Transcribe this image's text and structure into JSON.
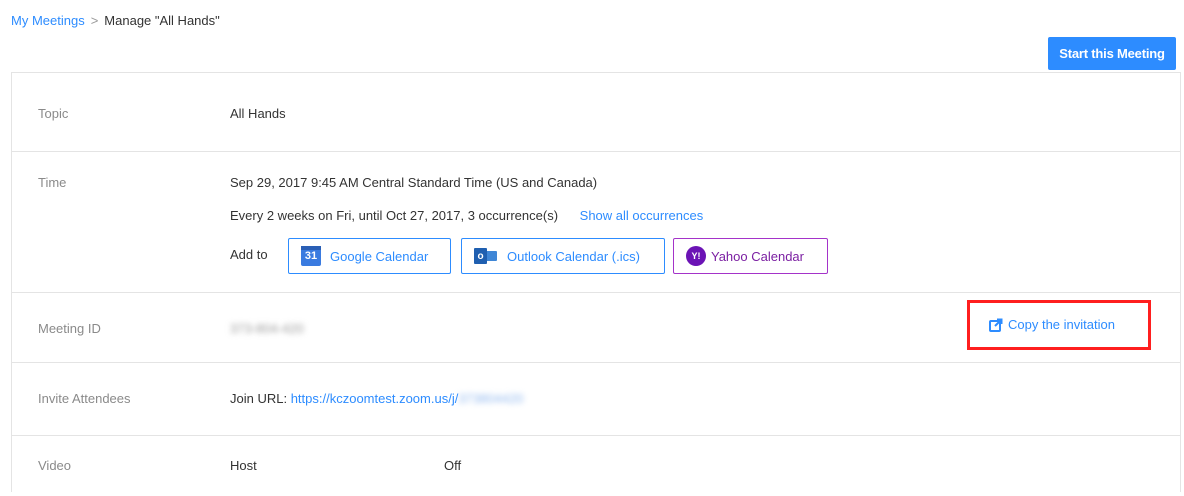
{
  "breadcrumb": {
    "parent": "My Meetings",
    "separator": ">",
    "current": "Manage \"All Hands\""
  },
  "start_button": {
    "label": "Start this Meeting"
  },
  "colors": {
    "accent": "#2d8cff",
    "highlight_box": "#ff1f1f",
    "yahoo": "#7b1fa2"
  },
  "rows": {
    "topic": {
      "label": "Topic",
      "value": "All Hands"
    },
    "time": {
      "label": "Time",
      "datetime": "Sep 29, 2017 9:45 AM Central Standard Time (US and Canada)",
      "recurrence": "Every 2 weeks on Fri, until Oct 27, 2017, 3 occurrence(s)",
      "show_all_link": "Show all occurrences",
      "add_to_label": "Add to",
      "calendars": {
        "google": {
          "label": "Google Calendar",
          "icon": "google-calendar-icon",
          "icon_text": "31"
        },
        "outlook": {
          "label": "Outlook Calendar (.ics)",
          "icon": "outlook-icon",
          "icon_text": "o"
        },
        "yahoo": {
          "label": "Yahoo Calendar",
          "icon": "yahoo-icon",
          "icon_text": "Y!"
        }
      }
    },
    "meeting_id": {
      "label": "Meeting ID",
      "value": "373-804-420"
    },
    "invite": {
      "label": "Invite Attendees",
      "join_prefix": "Join URL:",
      "join_url": "https://kczoomtest.zoom.us/j/",
      "join_url_hidden": "373804420",
      "copy_label": "Copy the invitation",
      "copy_icon": "copy-invitation-icon"
    },
    "video": {
      "label": "Video",
      "host_label": "Host",
      "host_value": "Off"
    }
  }
}
